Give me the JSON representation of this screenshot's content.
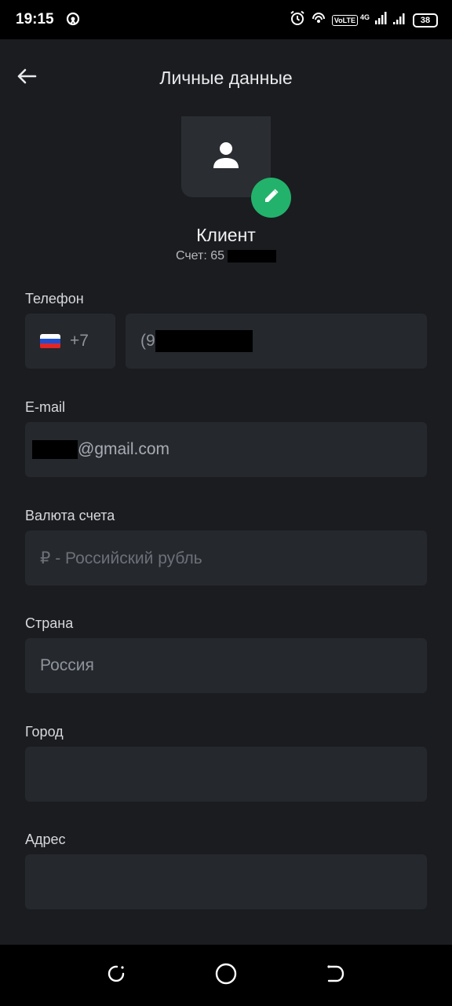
{
  "status_bar": {
    "time": "19:15",
    "battery": "38",
    "volte": "VoLTE",
    "network": "4G",
    "icons": [
      "hotspot-icon",
      "alarm-icon",
      "wifi-calling-icon",
      "signal-icon",
      "signal-icon-2",
      "battery-icon"
    ]
  },
  "header": {
    "title": "Личные данные",
    "back_icon": "arrow-left-icon"
  },
  "profile": {
    "name": "Клиент",
    "account_prefix": "Счет: 65",
    "avatar_icon": "person-icon",
    "edit_icon": "pencil-icon",
    "accent_color": "#23b26b"
  },
  "form": {
    "phone": {
      "label": "Телефон",
      "country_code": "+7",
      "number_prefix": "(9",
      "flag": "russia-flag-icon"
    },
    "email": {
      "label": "E-mail",
      "value_suffix": "@gmail.com"
    },
    "currency": {
      "label": "Валюта счета",
      "value": "₽ - Российский рубль"
    },
    "country": {
      "label": "Страна",
      "value": "Россия"
    },
    "city": {
      "label": "Город",
      "value": ""
    },
    "address": {
      "label": "Адрес",
      "value": ""
    }
  },
  "nav_bar": {
    "icons": [
      "recent-apps-icon",
      "home-icon",
      "back-icon"
    ]
  }
}
